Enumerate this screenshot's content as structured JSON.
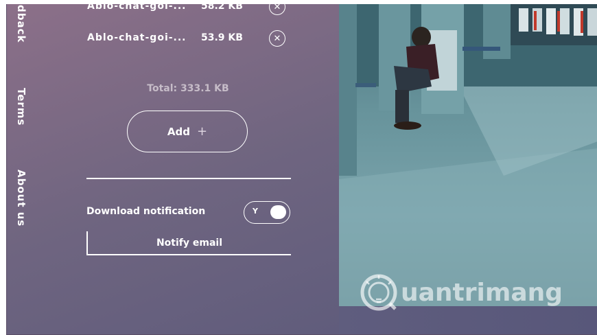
{
  "sidenav": {
    "feedback": "Feedback",
    "terms": "Terms",
    "about": "About us"
  },
  "files": [
    {
      "name": "Ablo-chat-goi-...",
      "size": "58.2 KB"
    },
    {
      "name": "Ablo-chat-goi-...",
      "size": "53.9 KB"
    }
  ],
  "total": "Total: 333.1 KB",
  "add_button": {
    "label": "Add",
    "icon": "+"
  },
  "notification": {
    "label": "Download notification",
    "toggle_label": "Y",
    "enabled": true
  },
  "notify_email": {
    "placeholder": "Notify email"
  },
  "watermark": {
    "text": "uantrimang"
  },
  "colors": {
    "panel_top": "#8c7089",
    "panel_bottom": "#59587a",
    "photo_tint": "#67939b"
  }
}
